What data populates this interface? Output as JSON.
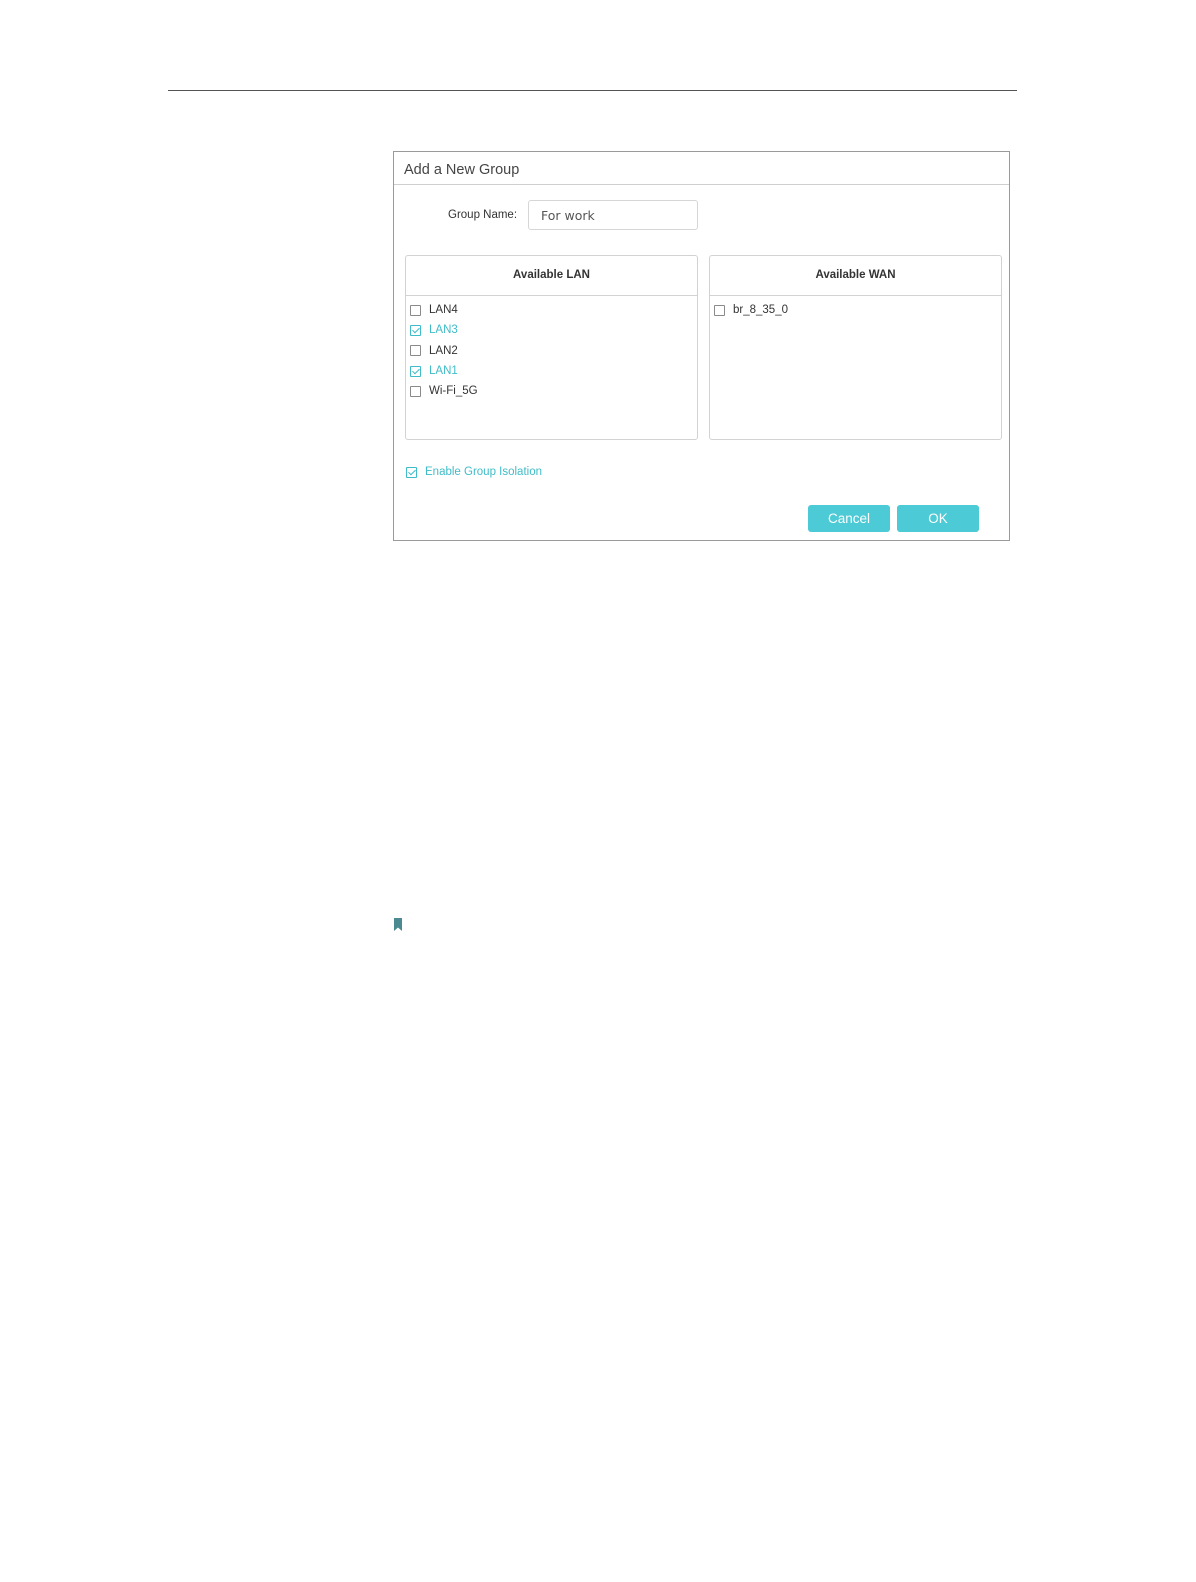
{
  "dialog": {
    "title": "Add a New Group",
    "group_name_label": "Group Name:",
    "group_name_value": "For work",
    "lan": {
      "header": "Available LAN",
      "items": [
        {
          "label": "LAN4",
          "checked": false
        },
        {
          "label": "LAN3",
          "checked": true
        },
        {
          "label": "LAN2",
          "checked": false
        },
        {
          "label": "LAN1",
          "checked": true
        },
        {
          "label": "Wi-Fi_5G",
          "checked": false
        }
      ]
    },
    "wan": {
      "header": "Available WAN",
      "items": [
        {
          "label": "br_8_35_0",
          "checked": false
        }
      ]
    },
    "isolation_label": "Enable Group Isolation",
    "isolation_checked": true,
    "cancel_label": "Cancel",
    "ok_label": "OK"
  },
  "colors": {
    "accent": "#4ccad5",
    "checked_text": "#3fbcc7",
    "note_icon": "#4a8a90"
  },
  "icons": {
    "note": "bookmark-icon"
  }
}
